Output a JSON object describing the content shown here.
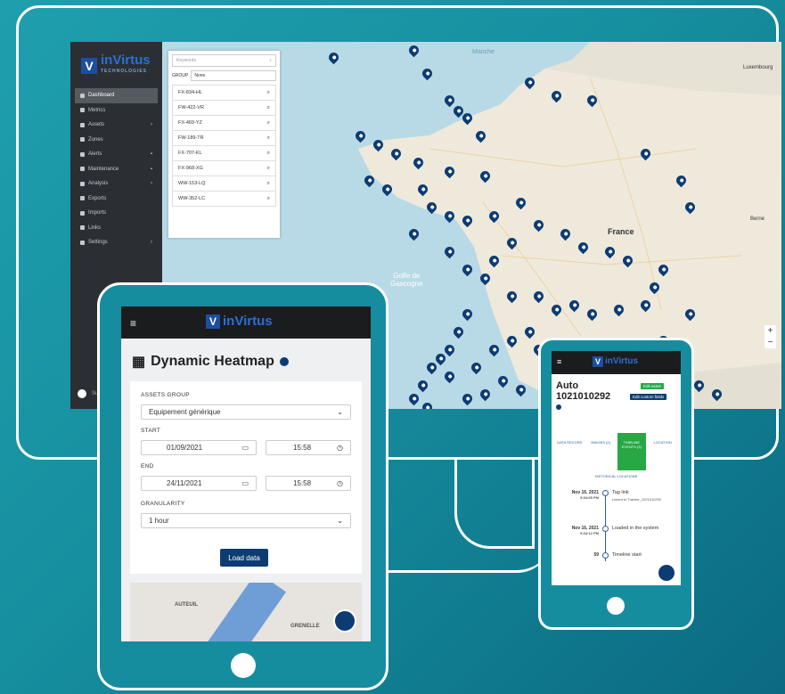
{
  "monitor": {
    "sidebar": {
      "brand": "inVirtus",
      "brand_sub": "TECHNOLOGIES",
      "items": [
        {
          "label": "Dashboard",
          "active": true
        },
        {
          "label": "Metrics"
        },
        {
          "label": "Assets",
          "arrow": "›"
        },
        {
          "label": "Zones"
        },
        {
          "label": "Alerts",
          "arrow": "▪"
        },
        {
          "label": "Maintenance",
          "arrow": "▪"
        },
        {
          "label": "Analysis",
          "arrow": "›"
        },
        {
          "label": "Exports"
        },
        {
          "label": "Imports"
        },
        {
          "label": "Links"
        },
        {
          "label": "Settings",
          "arrow": "›"
        }
      ],
      "user": "Supp"
    },
    "asset_panel": {
      "search_placeholder": "Keywords",
      "group_label": "GROUP",
      "group_value": "None",
      "assets": [
        "FX-834-HL",
        "FW-422-VR",
        "FX-469-YZ",
        "FW-189-TR",
        "FX-707-KL",
        "FX-968-XG",
        "WW-153-LQ",
        "WW-352-LC"
      ]
    },
    "map": {
      "country_label": "France",
      "sea_label": "Golfe de\nGascogne",
      "sea_label_north": "Manche",
      "city_labels": [
        "Luxembourg",
        "Berne"
      ]
    }
  },
  "tablet": {
    "brand": "inVirtus",
    "title": "Dynamic Heatmap",
    "assets_group_label": "ASSETS GROUP",
    "assets_group_value": "Equipement générique",
    "start_label": "START",
    "start_date": "01/09/2021",
    "start_time": "15:58",
    "end_label": "END",
    "end_date": "24/11/2021",
    "end_time": "15:58",
    "granularity_label": "GRANULARITY",
    "granularity_value": "1 hour",
    "load_button": "Load data",
    "map_labels": [
      "AUTEUIL",
      "GRENELLE"
    ]
  },
  "phone": {
    "brand": "inVirtus",
    "title_line1": "Auto",
    "title_line2": "1021010292",
    "edit_asset": "Edit asset",
    "edit_fields": "Edit custom fields",
    "tabs": [
      "DATA RECORD",
      "IMAGES (0)",
      "TIMELINE EVENTS (3)",
      "LOCATION"
    ],
    "history_link": "HISTORICAL LOCATIONS",
    "timeline": [
      {
        "date": "Nov 16, 2021",
        "time": "9:34:05 PM",
        "title": "Tag link",
        "sub": "Linked to Tracker_1021010292"
      },
      {
        "date": "Nov 16, 2021",
        "time": "9:34:12 PM",
        "title": "Loaded in the system",
        "sub": ""
      },
      {
        "date": "59",
        "time": "",
        "title": "Timeline start",
        "sub": ""
      }
    ]
  },
  "colors": {
    "background": "#168f9f",
    "brand_blue": "#0d3c73",
    "accent_green": "#28a745",
    "sidebar": "#2b2f33"
  }
}
